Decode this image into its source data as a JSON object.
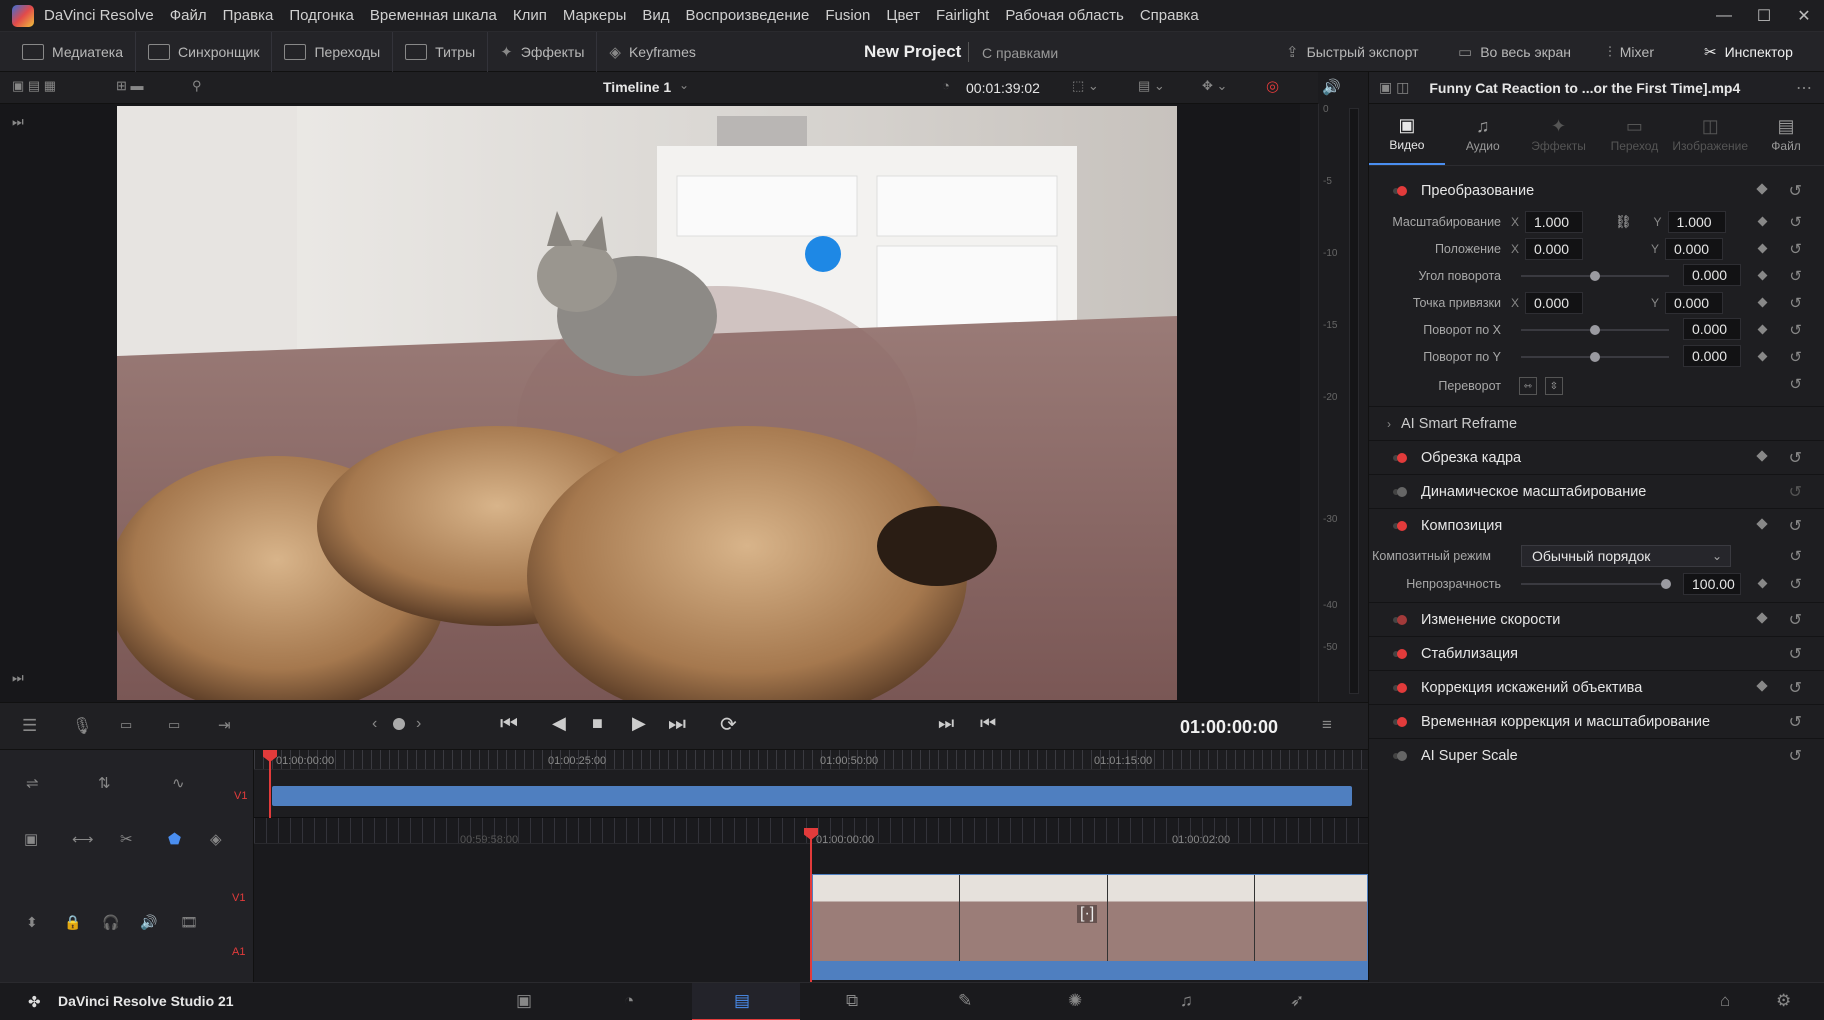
{
  "app": {
    "menu": [
      "DaVinci Resolve",
      "Файл",
      "Правка",
      "Подгонка",
      "Временная шкала",
      "Клип",
      "Маркеры",
      "Вид",
      "Воспроизведение",
      "Fusion",
      "Цвет",
      "Fairlight",
      "Рабочая область",
      "Справка"
    ]
  },
  "toolbar": {
    "left": [
      "Медиатека",
      "Синхронщик",
      "Переходы",
      "Титры",
      "Эффекты",
      "Keyframes"
    ],
    "project_title": "New Project",
    "project_subtitle": "С правками",
    "right": [
      "Быстрый экспорт",
      "Во весь экран",
      "Mixer",
      "Инспектор"
    ]
  },
  "viewer": {
    "timeline_name": "Timeline 1",
    "duration": "00:01:39:02",
    "level_ticks": [
      "0",
      "-5",
      "-10",
      "-15",
      "-20",
      "-30",
      "-40",
      "-50"
    ]
  },
  "transport": {
    "timecode": "01:00:00:00"
  },
  "timeline": {
    "top_ruler": [
      "01:00:00:00",
      "01:00:25:00",
      "01:00:50:00",
      "01:01:15:00"
    ],
    "bottom_ruler": [
      "00:59:58:00",
      "01:00:00:00",
      "01:00:02:00"
    ],
    "tracks": {
      "v1": "V1",
      "a1": "A1"
    }
  },
  "inspector": {
    "clip_name": "Funny Cat Reaction to ...or the First Time].mp4",
    "tabs": [
      "Видео",
      "Аудио",
      "Эффекты",
      "Переход",
      "Изображение",
      "Файл"
    ],
    "transform": {
      "title": "Преобразование",
      "scale_label": "Масштабирование",
      "scale_x": "1.000",
      "scale_y": "1.000",
      "position_label": "Положение",
      "position_x": "0.000",
      "position_y": "0.000",
      "rotation_label": "Угол поворота",
      "rotation": "0.000",
      "anchor_label": "Точка привязки",
      "anchor_x": "0.000",
      "anchor_y": "0.000",
      "pitch_label": "Поворот по X",
      "pitch": "0.000",
      "yaw_label": "Поворот по Y",
      "yaw": "0.000",
      "flip_label": "Переворот"
    },
    "smart_reframe": "AI Smart Reframe",
    "crop": "Обрезка кадра",
    "dynamic_zoom": "Динамическое масштабирование",
    "composite": {
      "title": "Композиция",
      "mode_label": "Композитный режим",
      "mode_value": "Обычный порядок",
      "opacity_label": "Непрозрачность",
      "opacity": "100.00"
    },
    "speed": "Изменение скорости",
    "stabilization": "Стабилизация",
    "lens": "Коррекция искажений объектива",
    "retime": "Временная коррекция и масштабирование",
    "superscale": "AI Super Scale",
    "axis_x": "X",
    "axis_y": "Y"
  },
  "status": {
    "app_name": "DaVinci Resolve Studio 21"
  },
  "colors": {
    "accent": "#4a8ef0",
    "playhead": "#e23b3b",
    "clip_blue": "#4f7fc0"
  }
}
